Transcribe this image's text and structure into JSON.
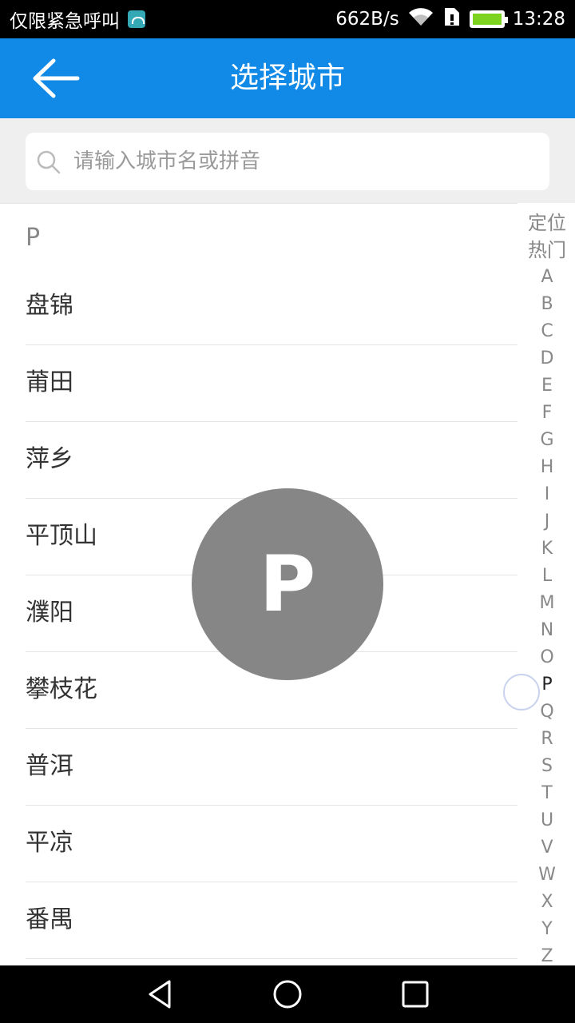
{
  "status_bar": {
    "carrier_text": "仅限紧急呼叫",
    "network_speed": "662B/s",
    "time": "13:28",
    "icons": [
      "android-debug-icon",
      "wifi-icon",
      "sim-icon",
      "battery-charging-icon"
    ]
  },
  "header": {
    "title": "选择城市",
    "back_icon": "arrow-left-icon",
    "background_color": "#1189e6"
  },
  "search": {
    "placeholder": "请输入城市名或拼音",
    "value": ""
  },
  "city_list": {
    "section_letter": "P",
    "cities": [
      "盘锦",
      "莆田",
      "萍乡",
      "平顶山",
      "濮阳",
      "攀枝花",
      "普洱",
      "平凉",
      "番禺"
    ]
  },
  "index_bar": {
    "items": [
      "定位",
      "热门",
      "A",
      "B",
      "C",
      "D",
      "E",
      "F",
      "G",
      "H",
      "I",
      "J",
      "K",
      "L",
      "M",
      "N",
      "O",
      "P",
      "Q",
      "R",
      "S",
      "T",
      "U",
      "V",
      "W",
      "X",
      "Y",
      "Z"
    ],
    "active": "P"
  },
  "overlay": {
    "letter": "P"
  },
  "nav_bar": {
    "icons": [
      "back-triangle-icon",
      "home-circle-icon",
      "recents-square-icon"
    ]
  }
}
